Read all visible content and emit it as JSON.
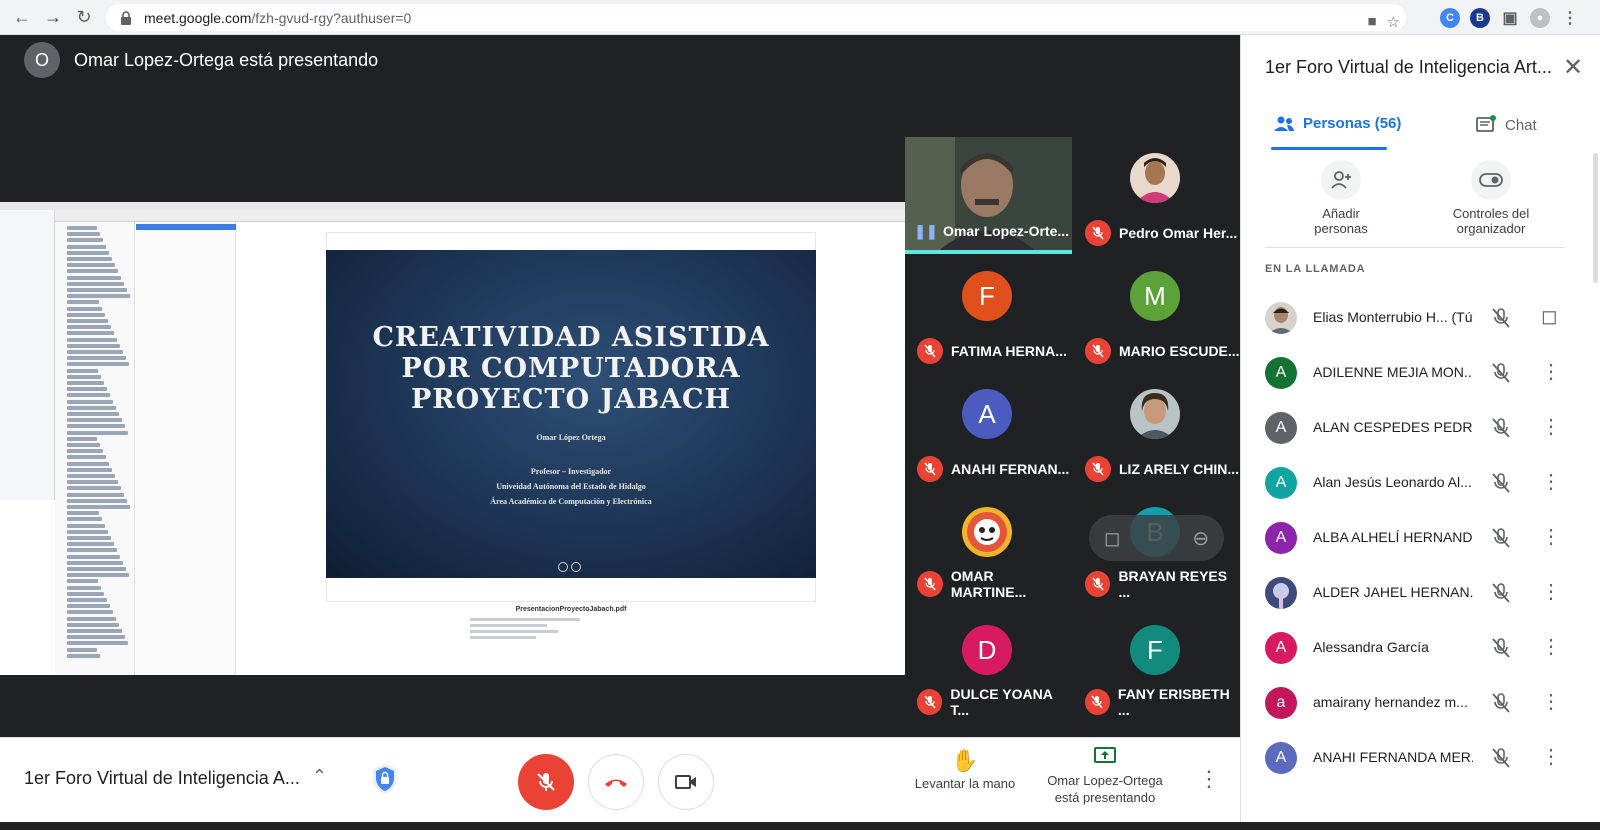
{
  "browser": {
    "url_host": "meet.google.com",
    "url_path": "/fzh-gvud-rgy?authuser=0"
  },
  "stage": {
    "presenter_initial": "O",
    "presenter_text": "Omar Lopez-Ortega está presentando"
  },
  "slide": {
    "title_line1": "CREATIVIDAD ASISTIDA",
    "title_line2": "POR COMPUTADORA",
    "title_line3": "PROYECTO JABACH",
    "author": "Omar López Ortega",
    "role": "Profesor – Investigador",
    "university": "Univeidad Autónoma del Estado de Hidalgo",
    "department": "Área Académica de Computación y Electrónica",
    "file_caption": "PresentacionProyectoJabach.pdf"
  },
  "tiles": [
    {
      "name": "Omar Lopez-Orte...",
      "initial": "",
      "color": "",
      "type": "video",
      "speaking": true
    },
    {
      "name": "Pedro Omar Her...",
      "initial": "",
      "color": "#c9a68a",
      "type": "photo"
    },
    {
      "name": "FATIMA HERNA...",
      "initial": "F",
      "color": "#e1501c",
      "type": "letter"
    },
    {
      "name": "MARIO ESCUDE...",
      "initial": "M",
      "color": "#5ba338",
      "type": "letter"
    },
    {
      "name": "ANAHI FERNAN...",
      "initial": "A",
      "color": "#4b5bbf",
      "type": "letter"
    },
    {
      "name": "LIZ ARELY CHIN...",
      "initial": "",
      "color": "#8a7a6a",
      "type": "photo"
    },
    {
      "name": "OMAR MARTINE...",
      "initial": "",
      "color": "#e4a21c",
      "type": "photo"
    },
    {
      "name": "BRAYAN REYES ...",
      "initial": "B",
      "color": "#129eaf",
      "type": "letter"
    },
    {
      "name": "DULCE YOANA T...",
      "initial": "D",
      "color": "#d81b60",
      "type": "letter"
    },
    {
      "name": "FANY ERISBETH ...",
      "initial": "F",
      "color": "#128a7e",
      "type": "letter"
    }
  ],
  "bottom": {
    "meeting_title": "1er Foro Virtual de Inteligencia A...",
    "raise_hand": "Levantar la mano",
    "presenting_line1": "Omar Lopez-Ortega",
    "presenting_line2": "está presentando"
  },
  "panel": {
    "title": "1er Foro Virtual de Inteligencia Art...",
    "tab_people": "Personas (56)",
    "tab_chat": "Chat",
    "add_people_line1": "Añadir",
    "add_people_line2": "personas",
    "host_controls_line1": "Controles del",
    "host_controls_line2": "organizador",
    "section_label": "EN LA LLAMADA",
    "participants": [
      {
        "name": "Elias Monterrubio H... (Tú)",
        "initial": "",
        "color": "#8d6e63",
        "photo": true,
        "self": true
      },
      {
        "name": "ADILENNE MEJIA MON...",
        "initial": "A",
        "color": "#137333"
      },
      {
        "name": "ALAN CESPEDES PEDR...",
        "initial": "A",
        "color": "#5f6368"
      },
      {
        "name": "Alan Jesús Leonardo Al...",
        "initial": "A",
        "color": "#12a4a0"
      },
      {
        "name": "ALBA ALHELÍ HERNAND...",
        "initial": "A",
        "color": "#8e24aa"
      },
      {
        "name": "ALDER JAHEL HERNAN...",
        "initial": "",
        "color": "#7b7fa6",
        "photo": true
      },
      {
        "name": "Alessandra García",
        "initial": "A",
        "color": "#d81b60"
      },
      {
        "name": "amairany hernandez m...",
        "initial": "a",
        "color": "#c2185b"
      },
      {
        "name": "ANAHI FERNANDA MER...",
        "initial": "A",
        "color": "#5c6bc0"
      }
    ]
  }
}
